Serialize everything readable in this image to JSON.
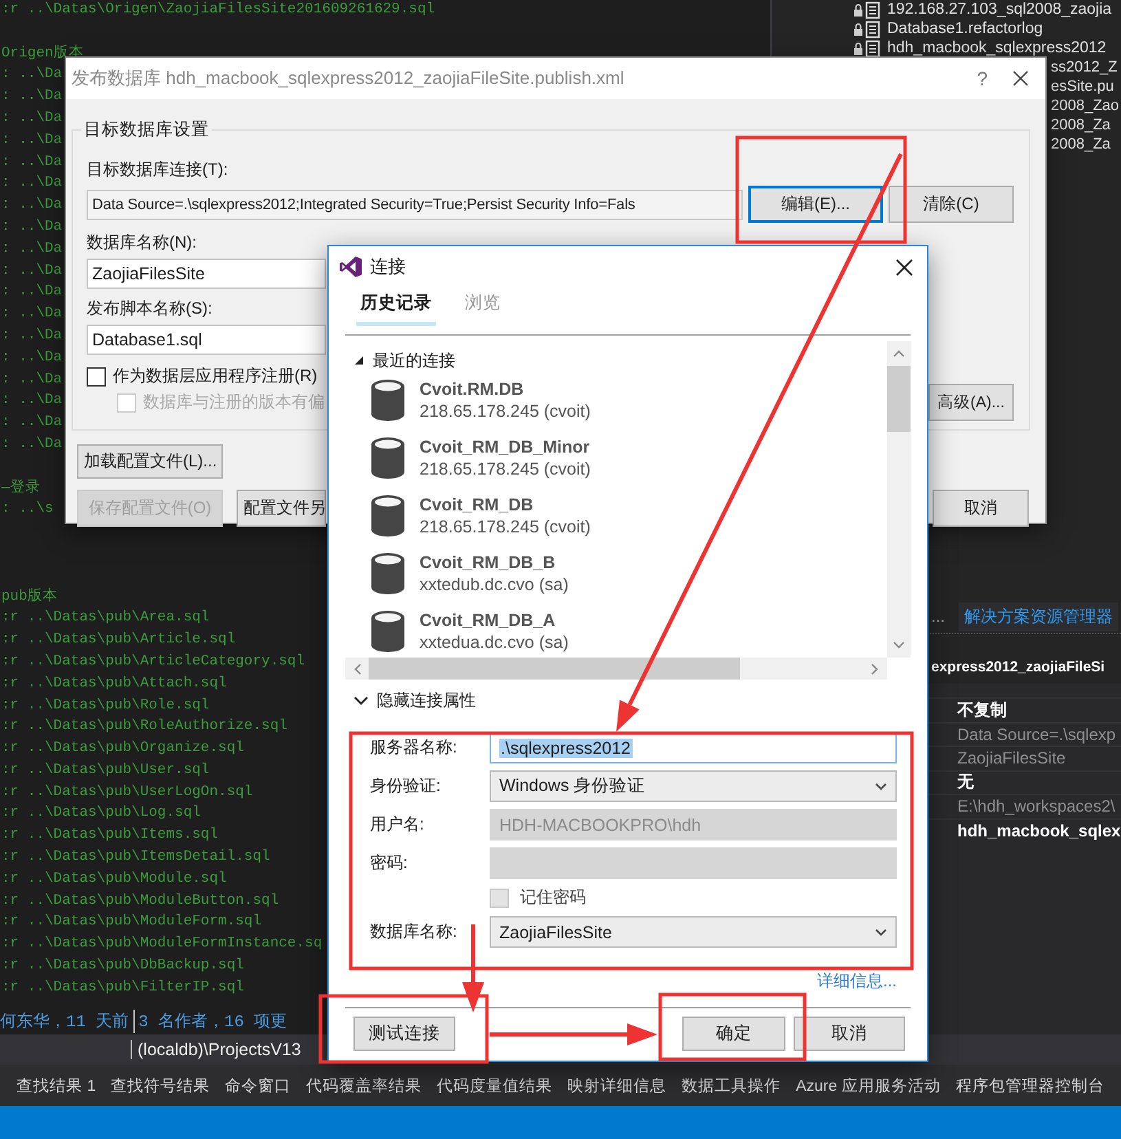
{
  "editor": {
    "lines": [
      {
        "kind": "code",
        "text": ":r ..\\Datas\\Origen\\ZaojiaFilesSite201609261629.sql"
      },
      {
        "kind": "blank"
      },
      {
        "kind": "code",
        "text": "Origen版本"
      },
      {
        "kind": "code",
        "text": ": ..\\Da"
      },
      {
        "kind": "code",
        "text": ": ..\\Da"
      },
      {
        "kind": "code",
        "text": ": ..\\Da"
      },
      {
        "kind": "code",
        "text": ": ..\\Da"
      },
      {
        "kind": "code",
        "text": ": ..\\Da"
      },
      {
        "kind": "code",
        "text": ": ..\\Da"
      },
      {
        "kind": "code",
        "text": ": ..\\Da"
      },
      {
        "kind": "code",
        "text": ": ..\\Da"
      },
      {
        "kind": "code",
        "text": ": ..\\Da"
      },
      {
        "kind": "code",
        "text": ": ..\\Da"
      },
      {
        "kind": "code",
        "text": ": ..\\Da"
      },
      {
        "kind": "code",
        "text": ": ..\\Da"
      },
      {
        "kind": "code",
        "text": ": ..\\Da"
      },
      {
        "kind": "code",
        "text": ": ..\\Da"
      },
      {
        "kind": "code",
        "text": ": ..\\Da"
      },
      {
        "kind": "code",
        "text": ": ..\\Da"
      },
      {
        "kind": "code",
        "text": ": ..\\Da"
      },
      {
        "kind": "code",
        "text": ": ..\\Da"
      },
      {
        "kind": "blank"
      },
      {
        "kind": "code",
        "text": "—登录"
      },
      {
        "kind": "code",
        "text": ": ..\\s"
      },
      {
        "kind": "blank"
      },
      {
        "kind": "blank"
      },
      {
        "kind": "blank"
      },
      {
        "kind": "code",
        "text": "pub版本"
      },
      {
        "kind": "code",
        "text": ":r ..\\Datas\\pub\\Area.sql"
      },
      {
        "kind": "code",
        "text": ":r ..\\Datas\\pub\\Article.sql"
      },
      {
        "kind": "code",
        "text": ":r ..\\Datas\\pub\\ArticleCategory.sql"
      },
      {
        "kind": "code",
        "text": ":r ..\\Datas\\pub\\Attach.sql"
      },
      {
        "kind": "code",
        "text": ":r ..\\Datas\\pub\\Role.sql"
      },
      {
        "kind": "code",
        "text": ":r ..\\Datas\\pub\\RoleAuthorize.sql"
      },
      {
        "kind": "code",
        "text": ":r ..\\Datas\\pub\\Organize.sql"
      },
      {
        "kind": "code",
        "text": ":r ..\\Datas\\pub\\User.sql"
      },
      {
        "kind": "code",
        "text": ":r ..\\Datas\\pub\\UserLogOn.sql"
      },
      {
        "kind": "code",
        "text": ":r ..\\Datas\\pub\\Log.sql"
      },
      {
        "kind": "code",
        "text": ":r ..\\Datas\\pub\\Items.sql"
      },
      {
        "kind": "code",
        "text": ":r ..\\Datas\\pub\\ItemsDetail.sql"
      },
      {
        "kind": "code",
        "text": ":r ..\\Datas\\pub\\Module.sql"
      },
      {
        "kind": "code",
        "text": ":r ..\\Datas\\pub\\ModuleButton.sql"
      },
      {
        "kind": "code",
        "text": ":r ..\\Datas\\pub\\ModuleForm.sql"
      },
      {
        "kind": "code",
        "text": ":r ..\\Datas\\pub\\ModuleFormInstance.sq"
      },
      {
        "kind": "code",
        "text": ":r ..\\Datas\\pub\\DbBackup.sql"
      },
      {
        "kind": "code",
        "text": ":r ..\\Datas\\pub\\FilterIP.sql"
      }
    ],
    "blame": [
      "何东华，11 天前",
      "3 名作者，16 项更"
    ],
    "connection_bar": [
      "(localdb)\\ProjectsV13"
    ]
  },
  "solution_explorer": {
    "items": [
      {
        "kind": "file",
        "text": "192.168.27.103_sql2008_zaojia"
      },
      {
        "kind": "file",
        "text": "Database1.refactorlog"
      },
      {
        "kind": "file",
        "text": "hdh_macbook_sqlexpress2012"
      },
      {
        "kind": "cut",
        "text": "ss2012_Z"
      },
      {
        "kind": "cut",
        "text": "esSite.pu"
      },
      {
        "kind": "cut",
        "text": "2008_Zao"
      },
      {
        "kind": "cut",
        "text": "2008_Za"
      },
      {
        "kind": "cut",
        "text": "2008_Za"
      }
    ]
  },
  "tool_tabs": [
    {
      "label": "...",
      "selected": false
    },
    {
      "label": "解决方案资源管理器",
      "selected": true
    }
  ],
  "properties": {
    "header": "express2012_zaojiaFileSi",
    "rows": [
      {
        "value": "不复制",
        "emphasized": true
      },
      {
        "value": "Data Source=.\\sqlexp",
        "emphasized": false
      },
      {
        "value": "ZaojiaFilesSite",
        "emphasized": false
      },
      {
        "value": "无",
        "emphasized": true
      },
      {
        "value": "E:\\hdh_workspaces2\\",
        "emphasized": false
      },
      {
        "value": "hdh_macbook_sqlex",
        "emphasized": true
      }
    ]
  },
  "bottom_tabs": [
    "查找结果 1",
    "查找符号结果",
    "命令窗口",
    "代码覆盖率结果",
    "代码度量值结果",
    "映射详细信息",
    "数据工具操作",
    "Azure 应用服务活动",
    "程序包管理器控制台"
  ],
  "publish_dialog": {
    "title": "发布数据库 hdh_macbook_sqlexpress2012_zaojiaFileSite.publish.xml",
    "help": "?",
    "group_title": "目标数据库设置",
    "connection_label": "目标数据库连接(T):",
    "connection_value": "Data Source=.\\sqlexpress2012;Integrated Security=True;Persist Security Info=Fals",
    "edit_button": "编辑(E)...",
    "clear_button": "清除(C)",
    "db_name_label": "数据库名称(N):",
    "db_name_value": "ZaojiaFilesSite",
    "script_label": "发布脚本名称(S):",
    "script_value": "Database1.sql",
    "checkboxes": [
      {
        "label": "作为数据层应用程序注册(R)",
        "checked": false,
        "disabled": false
      },
      {
        "label": "数据库与注册的版本有偏",
        "checked": false,
        "disabled": true
      }
    ],
    "advanced_button": "高级(A)...",
    "load_button": "加载配置文件(L)...",
    "save_buttons": [
      {
        "label": "保存配置文件(O)",
        "disabled": true
      },
      {
        "label": "配置文件另",
        "disabled": false
      }
    ],
    "cancel_button": "取消"
  },
  "connect_dialog": {
    "title": "连接",
    "tabs": [
      {
        "label": "历史记录",
        "selected": true
      },
      {
        "label": "浏览",
        "selected": false
      }
    ],
    "recent_group": {
      "label": "最近的连接",
      "expanded": true
    },
    "connections": [
      {
        "name": "Cvoit.RM.DB",
        "detail": "218.65.178.245 (cvoit)"
      },
      {
        "name": "Cvoit_RM_DB_Minor",
        "detail": "218.65.178.245 (cvoit)"
      },
      {
        "name": "Cvoit_RM_DB",
        "detail": "218.65.178.245 (cvoit)"
      },
      {
        "name": "Cvoit_RM_DB_B",
        "detail": "xxtedub.dc.cvo (sa)"
      },
      {
        "name": "Cvoit_RM_DB_A",
        "detail": "xxtedua.dc.cvo (sa)"
      }
    ],
    "properties_group": {
      "label": "隐藏连接属性",
      "expanded": true
    },
    "fields": [
      {
        "kind": "text",
        "label": "服务器名称:",
        "value": ".\\sqlexpress2012",
        "disabled": false,
        "focused": true
      },
      {
        "kind": "select",
        "label": "身份验证:",
        "value": "Windows 身份验证",
        "disabled": false,
        "focused": false
      },
      {
        "kind": "text",
        "label": "用户名:",
        "value": "HDH-MACBOOKPRO\\hdh",
        "disabled": true,
        "focused": false
      },
      {
        "kind": "text",
        "label": "密码:",
        "disabled": true,
        "focused": false
      },
      {
        "kind": "checkbox",
        "value": "记住密码",
        "checked": false,
        "disabled": true,
        "focused": false
      },
      {
        "kind": "select",
        "label": "数据库名称:",
        "value": "ZaojiaFilesSite",
        "disabled": false,
        "focused": false
      }
    ],
    "details_link": "详细信息...",
    "buttons": [
      "测试连接",
      "确定",
      "取消"
    ]
  }
}
